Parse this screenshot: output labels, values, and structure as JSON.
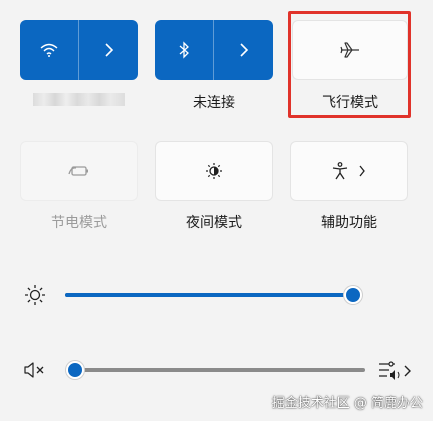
{
  "colors": {
    "accent": "#0b67c1",
    "highlight_border": "#e0322a"
  },
  "tiles": {
    "wifi": {
      "icon": "wifi-icon",
      "state": "on"
    },
    "bluetooth": {
      "icon": "bluetooth-icon",
      "state": "on",
      "label": "未连接"
    },
    "airplane": {
      "icon": "airplane-icon",
      "state": "off",
      "label": "飞行模式"
    },
    "battery_saver": {
      "icon": "battery-saver-icon",
      "state": "disabled",
      "label": "节电模式"
    },
    "night_light": {
      "icon": "night-light-icon",
      "state": "off",
      "label": "夜间模式"
    },
    "accessibility": {
      "icon": "accessibility-icon",
      "state": "off",
      "label": "辅助功能"
    }
  },
  "brightness": {
    "icon": "brightness-icon",
    "level_percent": 100
  },
  "volume": {
    "icon": "muted-speaker-icon",
    "level_percent": 0,
    "output_icon": "audio-output-icon"
  },
  "watermark": "掘金技术社区 @ 简鹿办公"
}
